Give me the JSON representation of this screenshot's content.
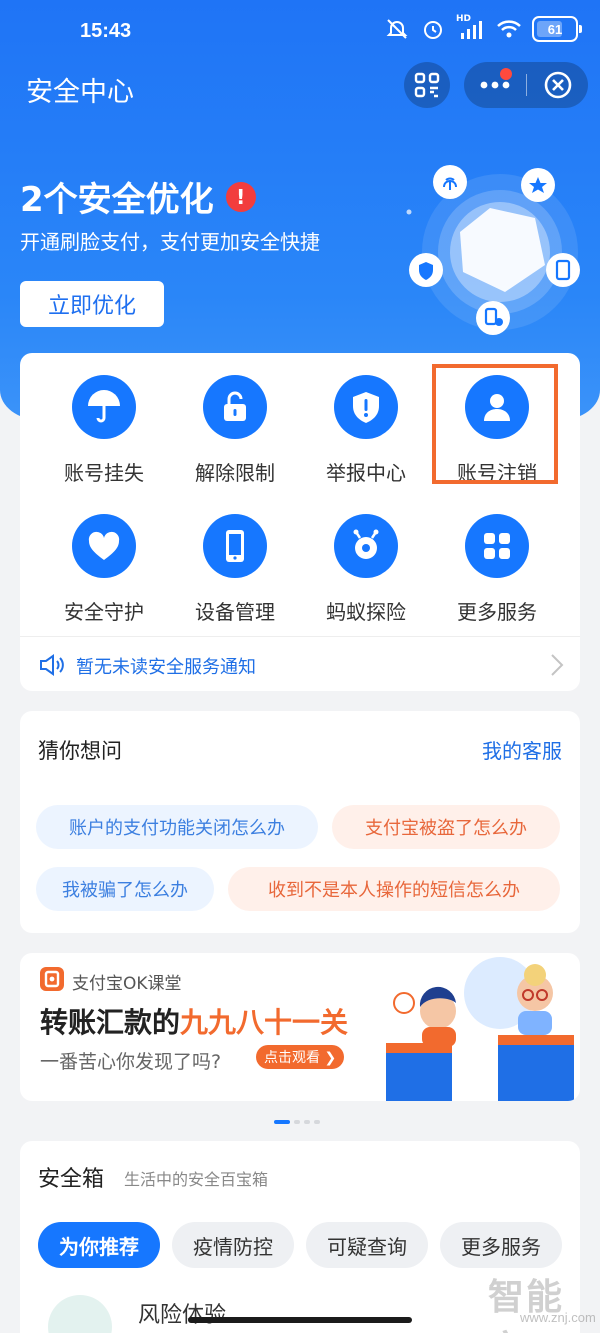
{
  "status_bar": {
    "time": "15:43",
    "network_label": "HD",
    "battery": "61"
  },
  "nav": {
    "title": "安全中心",
    "scan_icon": "scan-icon",
    "more_icon": "more-dots-icon",
    "close_icon": "close-circle-icon"
  },
  "hero": {
    "title": "2个安全优化",
    "alert_mark": "!",
    "subtitle": "开通刷脸支付，支付更加安全快捷",
    "button": "立即优化"
  },
  "services": [
    {
      "label": "账号挂失",
      "icon": "umbrella-icon"
    },
    {
      "label": "解除限制",
      "icon": "unlock-icon"
    },
    {
      "label": "举报中心",
      "icon": "shield-alert-icon"
    },
    {
      "label": "账号注销",
      "icon": "user-icon",
      "highlighted": true
    },
    {
      "label": "安全守护",
      "icon": "heart-icon"
    },
    {
      "label": "设备管理",
      "icon": "phone-icon"
    },
    {
      "label": "蚂蚁探险",
      "icon": "ant-icon"
    },
    {
      "label": "更多服务",
      "icon": "grid-icon"
    }
  ],
  "notice": {
    "text": "暂无未读安全服务通知",
    "icon": "speaker-icon"
  },
  "faq": {
    "title": "猜你想问",
    "link": "我的客服",
    "questions": [
      {
        "text": "账户的支付功能关闭怎么办",
        "tone": "blue"
      },
      {
        "text": "支付宝被盗了怎么办",
        "tone": "orange"
      },
      {
        "text": "我被骗了怎么办",
        "tone": "blue"
      },
      {
        "text": "收到不是本人操作的短信怎么办",
        "tone": "orange"
      }
    ]
  },
  "banner": {
    "brand": "支付宝OK课堂",
    "title_prefix": "转账汇款的",
    "title_highlight": "九九八十一关",
    "subtitle": "一番苦心你发现了吗?",
    "cta": "点击观看 ❯"
  },
  "carousel": {
    "count": 4,
    "active_index": 0
  },
  "safebox": {
    "title": "安全箱",
    "subtitle": "生活中的安全百宝箱",
    "tabs": [
      {
        "label": "为你推荐",
        "active": true
      },
      {
        "label": "疫情防控",
        "active": false
      },
      {
        "label": "可疑查询",
        "active": false
      },
      {
        "label": "更多服务",
        "active": false
      }
    ],
    "peek_item": "风险体验"
  },
  "watermark": {
    "text": "智能家",
    "url": "www.znj.com"
  },
  "colors": {
    "primary": "#1677ff",
    "hero": "#1f74f6",
    "accent": "#f26a2e",
    "alert": "#f23d3d"
  }
}
